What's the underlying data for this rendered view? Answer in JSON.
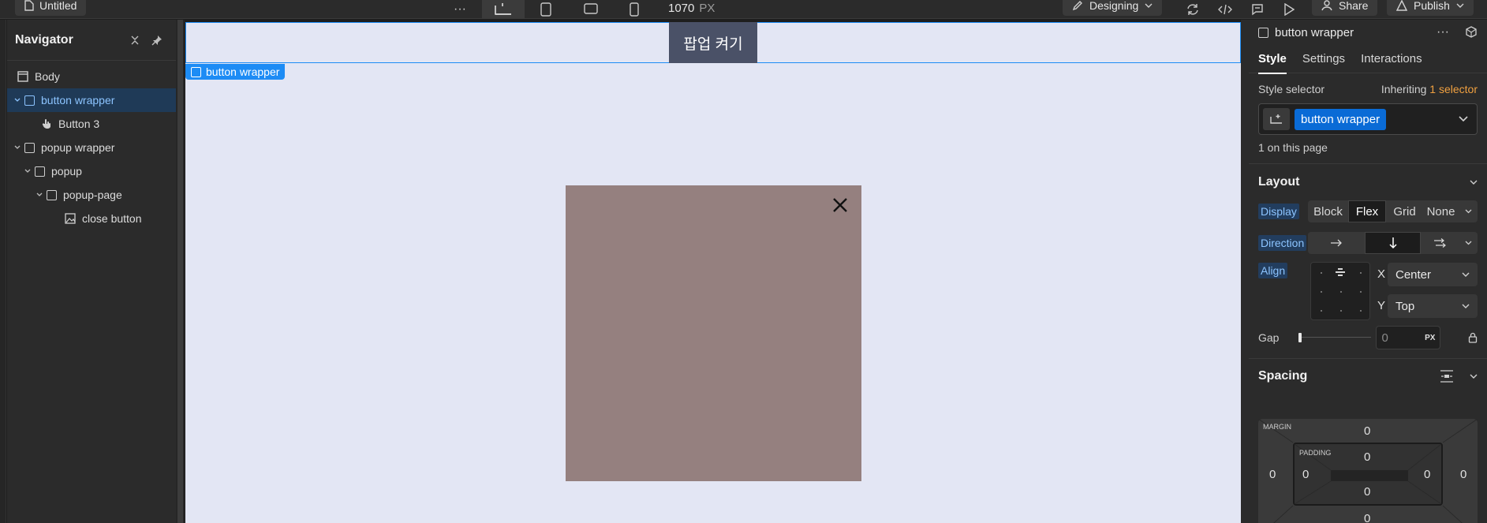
{
  "topbar": {
    "page_name": "Untitled",
    "more_label": "···",
    "width_value": "1070",
    "width_unit": "PX",
    "mode": "Designing",
    "share_label": "Share",
    "publish_label": "Publish"
  },
  "navigator": {
    "title": "Navigator",
    "items": [
      {
        "label": "Body",
        "icon": "body-icon"
      },
      {
        "label": "button wrapper",
        "icon": "div-icon"
      },
      {
        "label": "Button 3",
        "icon": "pointer-icon"
      },
      {
        "label": "popup wrapper",
        "icon": "div-icon"
      },
      {
        "label": "popup",
        "icon": "div-icon"
      },
      {
        "label": "popup-page",
        "icon": "div-icon"
      },
      {
        "label": "close button",
        "icon": "image-icon"
      }
    ]
  },
  "canvas": {
    "button_text": "팝업 켜기",
    "selection_tag": "button wrapper",
    "colors": {
      "background": "#e3e6f4",
      "button": "#4a5167",
      "popup": "#95807f",
      "selection": "#1d8cf5"
    }
  },
  "panel": {
    "element_name": "button wrapper",
    "tabs": [
      "Style",
      "Settings",
      "Interactions"
    ],
    "style_selector_label": "Style selector",
    "inheriting_label": "Inheriting",
    "inheriting_count": "1 selector",
    "selector_chip": "button wrapper",
    "on_page": "1 on this page",
    "layout": {
      "title": "Layout",
      "display_label": "Display",
      "display_options": [
        "Block",
        "Flex",
        "Grid",
        "None"
      ],
      "display_selected": "Flex",
      "direction_label": "Direction",
      "direction_selected": "vertical",
      "align_label": "Align",
      "x_label": "X",
      "x_value": "Center",
      "y_label": "Y",
      "y_value": "Top",
      "gap_label": "Gap",
      "gap_value": "0",
      "gap_unit": "PX"
    },
    "spacing": {
      "title": "Spacing",
      "margin_label": "MARGIN",
      "padding_label": "PADDING",
      "margin": {
        "top": "0",
        "right": "0",
        "bottom": "0",
        "left": "0"
      },
      "padding": {
        "top": "0",
        "right": "0",
        "bottom": "0",
        "left": "0"
      }
    }
  }
}
